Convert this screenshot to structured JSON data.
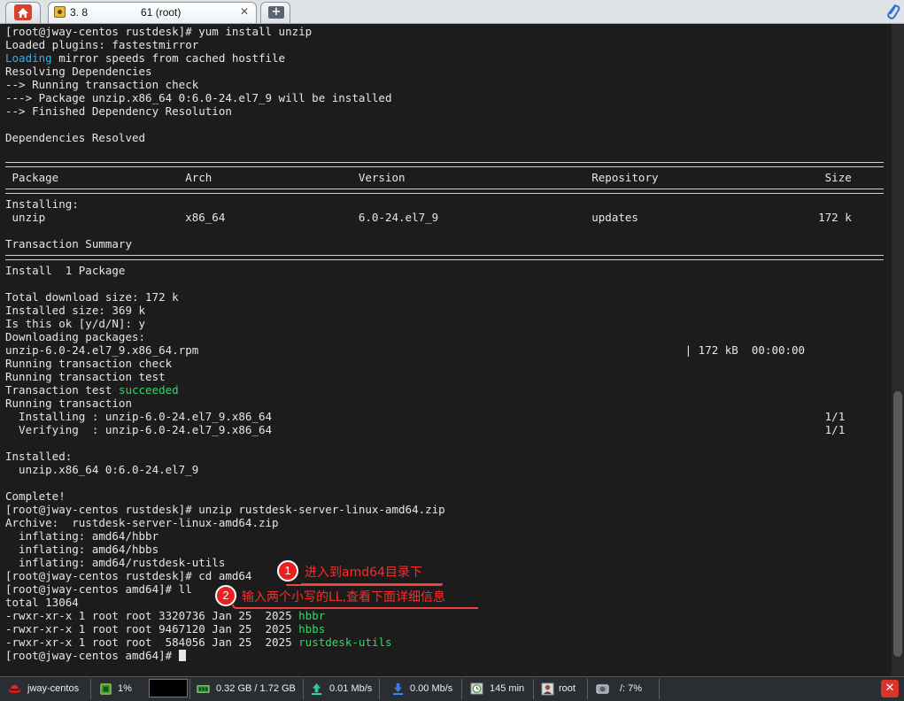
{
  "tabs": {
    "session_title": "3. 8     61 (root)",
    "close_glyph": "✕",
    "new_tab_glyph": "+"
  },
  "terminal": {
    "lines": [
      {
        "segments": [
          {
            "t": "[root@jway-centos rustdesk]# yum install unzip"
          }
        ]
      },
      {
        "segments": [
          {
            "t": "Loaded plugins: fastestmirror"
          }
        ]
      },
      {
        "segments": [
          {
            "t": "Loading",
            "c": "blue"
          },
          {
            "t": " mirror speeds from cached hostfile"
          }
        ]
      },
      {
        "segments": [
          {
            "t": "Resolving Dependencies"
          }
        ]
      },
      {
        "segments": [
          {
            "t": "--> Running transaction check"
          }
        ]
      },
      {
        "segments": [
          {
            "t": "---> Package unzip.x86_64 0:6.0-24.el7_9 will be installed"
          }
        ]
      },
      {
        "segments": [
          {
            "t": "--> Finished Dependency Resolution"
          }
        ]
      },
      {
        "segments": [
          {
            "t": ""
          }
        ]
      },
      {
        "segments": [
          {
            "t": "Dependencies Resolved"
          }
        ]
      },
      {
        "segments": [
          {
            "t": ""
          }
        ]
      },
      {
        "sep": true
      },
      {
        "segments": [
          {
            "t": " Package                   Arch                      Version                            Repository                         Size"
          }
        ]
      },
      {
        "sep": true
      },
      {
        "segments": [
          {
            "t": "Installing:"
          }
        ]
      },
      {
        "segments": [
          {
            "t": " unzip                     x86_64                    6.0-24.el7_9                       updates                           172 k"
          }
        ]
      },
      {
        "segments": [
          {
            "t": ""
          }
        ]
      },
      {
        "segments": [
          {
            "t": "Transaction Summary"
          }
        ]
      },
      {
        "sep": true
      },
      {
        "segments": [
          {
            "t": "Install  1 Package"
          }
        ]
      },
      {
        "segments": [
          {
            "t": ""
          }
        ]
      },
      {
        "segments": [
          {
            "t": "Total download size: 172 k"
          }
        ]
      },
      {
        "segments": [
          {
            "t": "Installed size: 369 k"
          }
        ]
      },
      {
        "segments": [
          {
            "t": "Is this ok [y/d/N]: y"
          }
        ]
      },
      {
        "segments": [
          {
            "t": "Downloading packages:"
          }
        ]
      },
      {
        "segments": [
          {
            "t": "unzip-6.0-24.el7_9.x86_64.rpm                                                                         | 172 kB  00:00:00"
          }
        ]
      },
      {
        "segments": [
          {
            "t": "Running transaction check"
          }
        ]
      },
      {
        "segments": [
          {
            "t": "Running transaction test"
          }
        ]
      },
      {
        "segments": [
          {
            "t": "Transaction test "
          },
          {
            "t": "succeeded",
            "c": "green"
          }
        ]
      },
      {
        "segments": [
          {
            "t": "Running transaction"
          }
        ]
      },
      {
        "segments": [
          {
            "t": "  Installing : unzip-6.0-24.el7_9.x86_64                                                                                   1/1"
          }
        ]
      },
      {
        "segments": [
          {
            "t": "  Verifying  : unzip-6.0-24.el7_9.x86_64                                                                                   1/1"
          }
        ]
      },
      {
        "segments": [
          {
            "t": ""
          }
        ]
      },
      {
        "segments": [
          {
            "t": "Installed:"
          }
        ]
      },
      {
        "segments": [
          {
            "t": "  unzip.x86_64 0:6.0-24.el7_9"
          }
        ]
      },
      {
        "segments": [
          {
            "t": ""
          }
        ]
      },
      {
        "segments": [
          {
            "t": "Complete!"
          }
        ]
      },
      {
        "segments": [
          {
            "t": "[root@jway-centos rustdesk]# unzip rustdesk-server-linux-amd64.zip"
          }
        ]
      },
      {
        "segments": [
          {
            "t": "Archive:  rustdesk-server-linux-amd64.zip"
          }
        ]
      },
      {
        "segments": [
          {
            "t": "  inflating: amd64/hbbr"
          }
        ]
      },
      {
        "segments": [
          {
            "t": "  inflating: amd64/hbbs"
          }
        ]
      },
      {
        "segments": [
          {
            "t": "  inflating: amd64/rustdesk-utils"
          }
        ]
      },
      {
        "segments": [
          {
            "t": "[root@jway-centos rustdesk]# cd amd64"
          }
        ]
      },
      {
        "segments": [
          {
            "t": "[root@jway-centos amd64]# ll"
          }
        ]
      },
      {
        "segments": [
          {
            "t": "total 13064"
          }
        ]
      },
      {
        "segments": [
          {
            "t": "-rwxr-xr-x 1 root root 3320736 Jan 25  2025 "
          },
          {
            "t": "hbbr",
            "c": "green"
          }
        ]
      },
      {
        "segments": [
          {
            "t": "-rwxr-xr-x 1 root root 9467120 Jan 25  2025 "
          },
          {
            "t": "hbbs",
            "c": "green"
          }
        ]
      },
      {
        "segments": [
          {
            "t": "-rwxr-xr-x 1 root root  584056 Jan 25  2025 "
          },
          {
            "t": "rustdesk-utils",
            "c": "green"
          }
        ]
      },
      {
        "segments": [
          {
            "t": "[root@jway-centos amd64]# "
          }
        ],
        "cursor": true
      }
    ]
  },
  "annotations": {
    "step1_number": "1",
    "step1_text": "进入到amd64目录下",
    "step2_number": "2",
    "step2_text": "输入两个小写的LL,查看下面详细信息"
  },
  "statusbar": {
    "host": "jway-centos",
    "cpu": "1%",
    "memory": "0.32 GB / 1.72 GB",
    "upload": "0.01 Mb/s",
    "download": "0.00 Mb/s",
    "uptime": "145 min",
    "user": "root",
    "disk": "/: 7%",
    "close_glyph": "✕"
  },
  "colors": {
    "terminal_bg": "#1c1c1c",
    "terminal_fg": "#e6e6e6",
    "highlight_blue": "#2fb3ee",
    "highlight_green": "#3ad36a",
    "annotation_red": "#e82020"
  }
}
